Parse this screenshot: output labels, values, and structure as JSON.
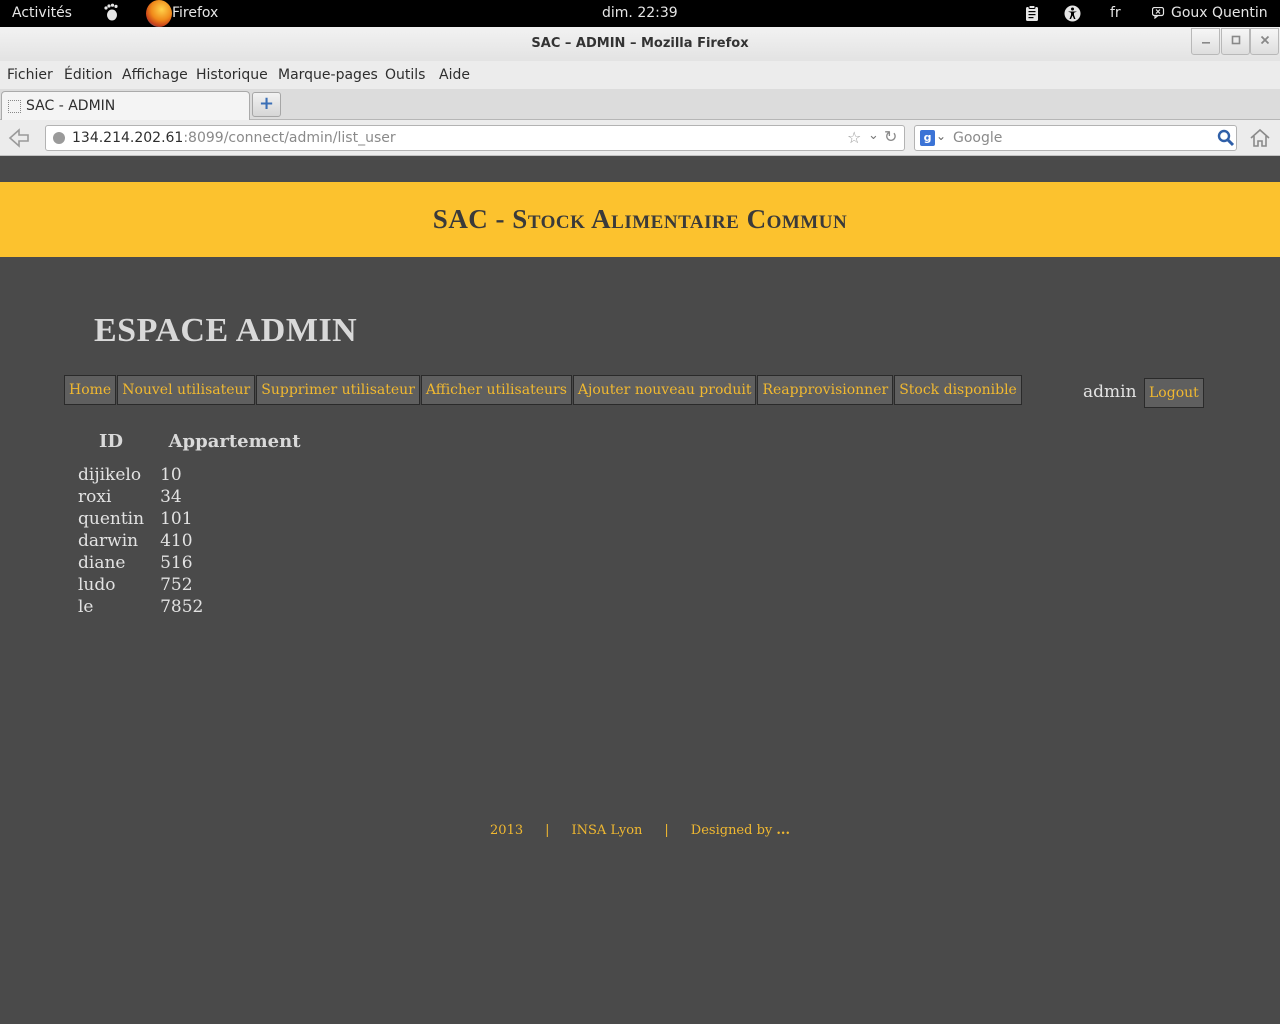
{
  "topbar": {
    "activities": "Activités",
    "app_name": "Firefox",
    "clock": "dim. 22:39",
    "lang": "fr",
    "user": "Goux Quentin"
  },
  "window": {
    "title": "SAC – ADMIN – Mozilla Firefox"
  },
  "menubar": {
    "items": [
      "Fichier",
      "Édition",
      "Affichage",
      "Historique",
      "Marque-pages",
      "Outils",
      "Aide"
    ]
  },
  "tabs": [
    {
      "label": "SAC - ADMIN"
    }
  ],
  "navbar": {
    "url_host": "134.214.202.61",
    "url_rest": ":8099/connect/admin/list_user",
    "search_placeholder": "Google",
    "search_engine_letter": "g"
  },
  "page": {
    "banner_title": "SAC - Stock Alimentaire Commun",
    "heading": "ESPACE ADMIN",
    "nav": [
      "Home",
      "Nouvel utilisateur",
      "Supprimer utilisateur",
      "Afficher utilisateurs",
      "Ajouter nouveau produit",
      "Reapprovisionner",
      "Stock disponible"
    ],
    "username": "admin",
    "logout": "Logout",
    "table": {
      "headers": [
        "ID",
        "Appartement"
      ],
      "rows": [
        [
          "dijikelo",
          "10"
        ],
        [
          "roxi",
          "34"
        ],
        [
          "quentin",
          "101"
        ],
        [
          "darwin",
          "410"
        ],
        [
          "diane",
          "516"
        ],
        [
          "ludo",
          "752"
        ],
        [
          "le",
          "7852"
        ]
      ]
    },
    "footer": {
      "year": "2013",
      "sep": "|",
      "org": "INSA Lyon",
      "designed": "Designed by",
      "dots": "..."
    }
  },
  "colors": {
    "page_bg": "#4a4a4a",
    "banner": "#fcc22e",
    "link": "#f0b830",
    "text_light": "#e2e2e2"
  }
}
